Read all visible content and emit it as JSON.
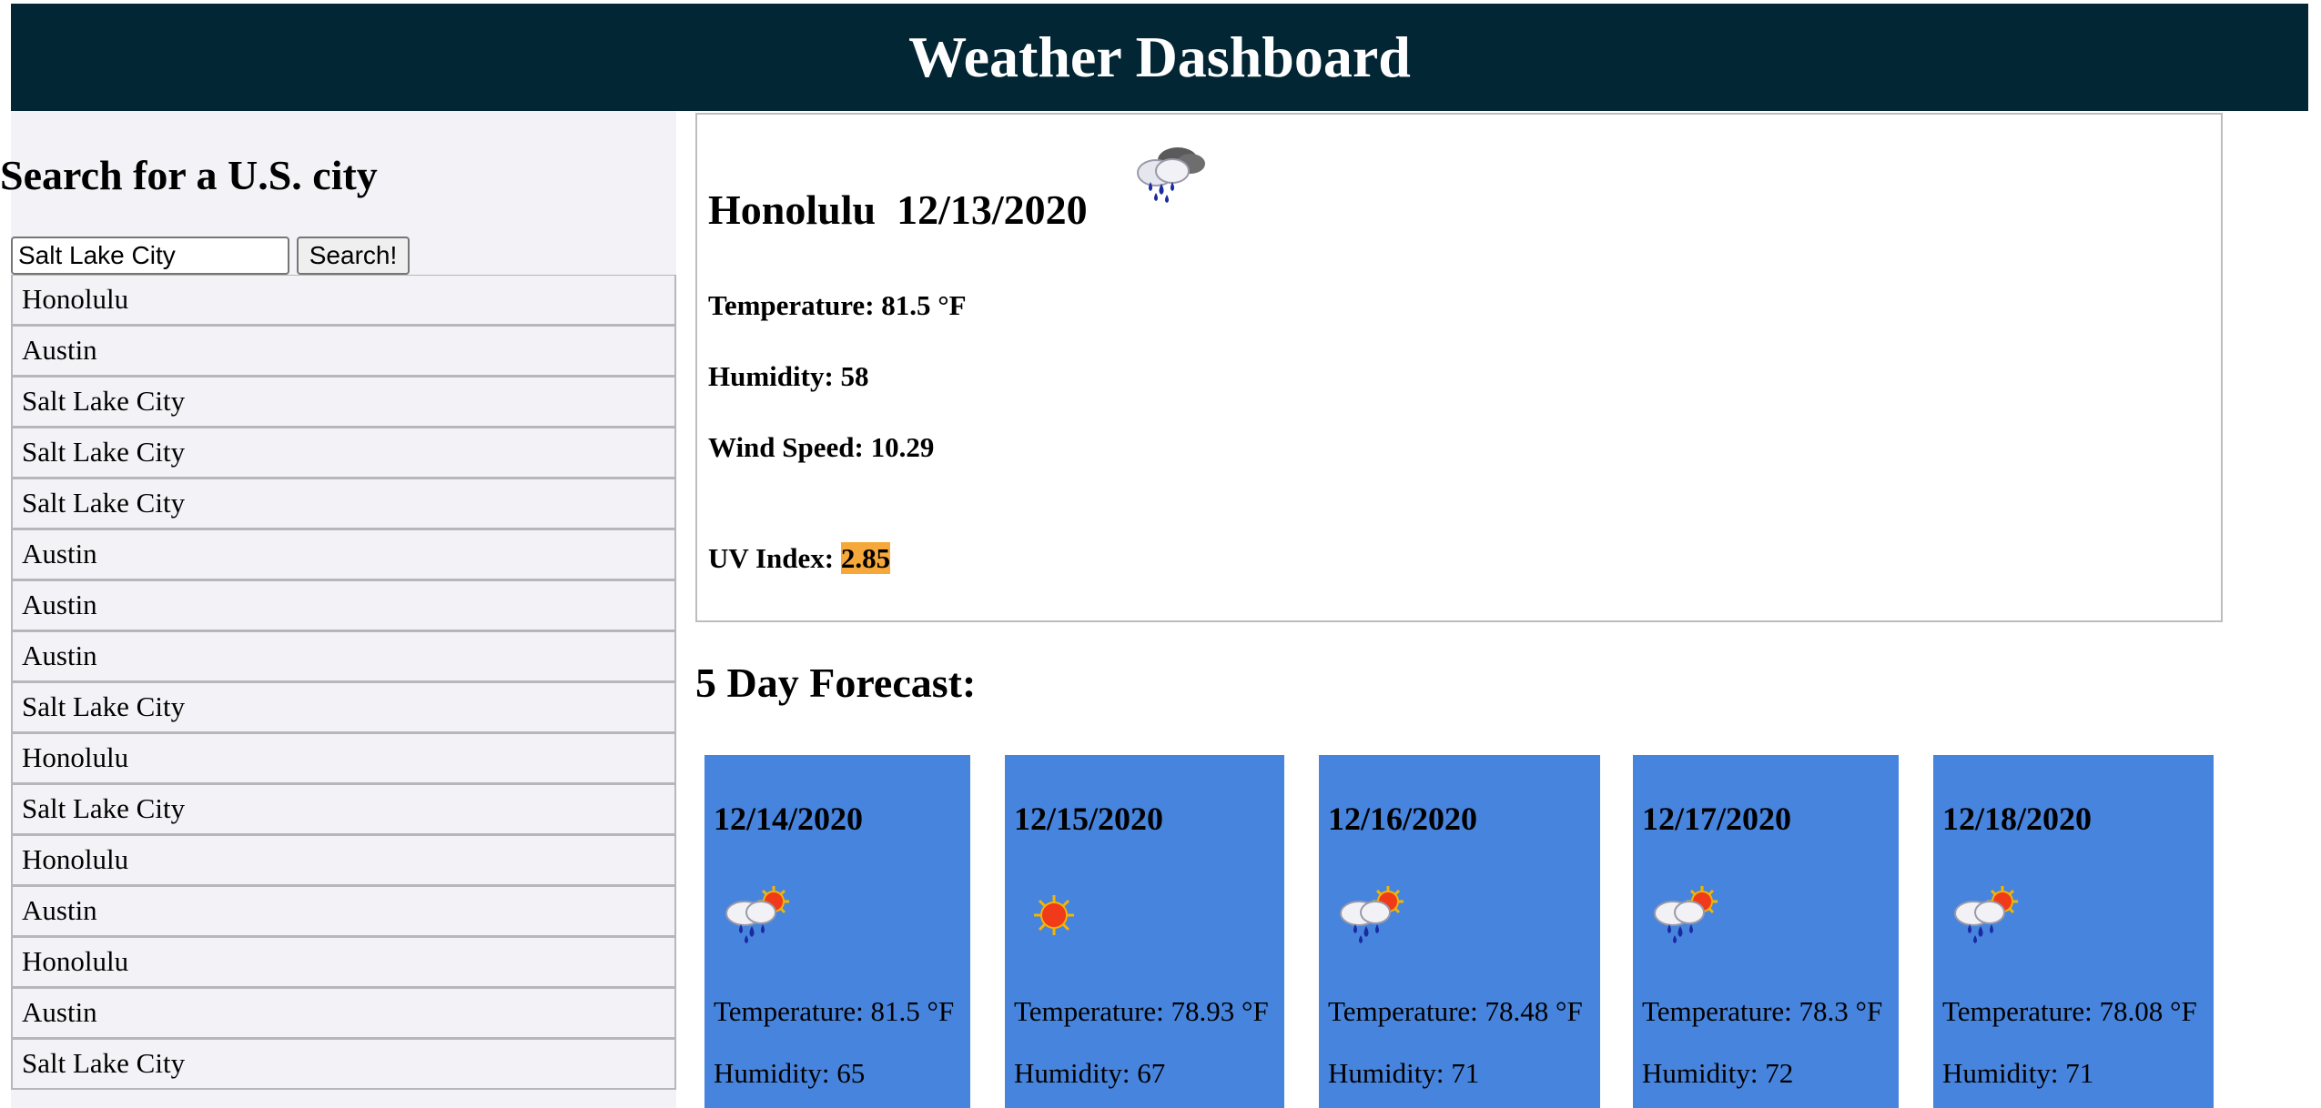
{
  "header": {
    "title": "Weather Dashboard"
  },
  "sidebar": {
    "heading": "Search for a U.S. city",
    "search": {
      "value": "Salt Lake City",
      "button_label": "Search!"
    },
    "history": [
      "Honolulu",
      "Austin",
      "Salt Lake City",
      "Salt Lake City",
      "Salt Lake City",
      "Austin",
      "Austin",
      "Austin",
      "Salt Lake City",
      "Honolulu",
      "Salt Lake City",
      "Honolulu",
      "Austin",
      "Honolulu",
      "Austin",
      "Salt Lake City"
    ]
  },
  "current": {
    "city": "Honolulu",
    "date": "12/13/2020",
    "icon": "rain-cloud-icon",
    "temperature_label": "Temperature: 81.5 °F",
    "humidity_label": "Humidity: 58",
    "wind_label": "Wind Speed: 10.29",
    "uv_label": "UV Index: ",
    "uv_value": "2.85",
    "uv_color": "#f6a93a"
  },
  "forecast": {
    "heading": "5 Day Forecast:",
    "card_color": "#4784dd",
    "days": [
      {
        "date": "12/14/2020",
        "icon": "sun-rain-cloud-icon",
        "temperature": "Temperature: 81.5 °F",
        "humidity": "Humidity: 65"
      },
      {
        "date": "12/15/2020",
        "icon": "sun-icon",
        "temperature": "Temperature: 78.93 °F",
        "humidity": "Humidity: 67"
      },
      {
        "date": "12/16/2020",
        "icon": "sun-rain-cloud-icon",
        "temperature": "Temperature: 78.48 °F",
        "humidity": "Humidity: 71"
      },
      {
        "date": "12/17/2020",
        "icon": "sun-rain-cloud-icon",
        "temperature": "Temperature: 78.3 °F",
        "humidity": "Humidity: 72"
      },
      {
        "date": "12/18/2020",
        "icon": "sun-rain-cloud-icon",
        "temperature": "Temperature: 78.08 °F",
        "humidity": "Humidity: 71"
      }
    ]
  }
}
